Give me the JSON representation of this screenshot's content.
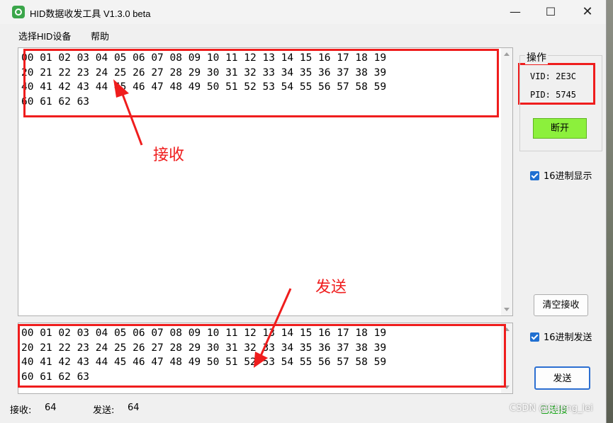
{
  "window": {
    "title": "HID数据收发工具 V1.3.0 beta",
    "minimize_icon": "—",
    "maximize_icon": "☐",
    "close_icon": "✕"
  },
  "menu": {
    "items": [
      "选择HID设备",
      "帮助"
    ]
  },
  "receive": {
    "lines": [
      "00 01 02 03 04 05 06 07 08 09 10 11 12 13 14 15 16 17 18 19",
      "20 21 22 23 24 25 26 27 28 29 30 31 32 33 34 35 36 37 38 39",
      "40 41 42 43 44 45 46 47 48 49 50 51 52 53 54 55 56 57 58 59",
      "60 61 62 63"
    ]
  },
  "send": {
    "lines": [
      "00 01 02 03 04 05 06 07 08 09 10 11 12 13 14 15 16 17 18 19",
      "20 21 22 23 24 25 26 27 28 29 30 31 32 33 34 35 36 37 38 39",
      "40 41 42 43 44 45 46 47 48 49 50 51 52 53 54 55 56 57 58 59",
      "60 61 62 63"
    ]
  },
  "annotations": {
    "receive_label": "接收",
    "send_label": "发送",
    "color": "#ef1d1d"
  },
  "panel": {
    "group_title": "操作",
    "vid": "VID: 2E3C",
    "pid": "PID: 5745",
    "disconnect_label": "断开",
    "hex_display_label": "16进制显示",
    "hex_display_checked": true,
    "clear_receive_label": "清空接收",
    "hex_send_label": "16进制发送",
    "hex_send_checked": true,
    "send_label": "发送",
    "accent_color": "#8cf03c"
  },
  "status": {
    "receive_label": "接收:",
    "receive_count": "64",
    "send_label": "发送:",
    "send_count": "64",
    "connection": "已连接"
  },
  "watermark": "CSDN @Cheng_lei"
}
